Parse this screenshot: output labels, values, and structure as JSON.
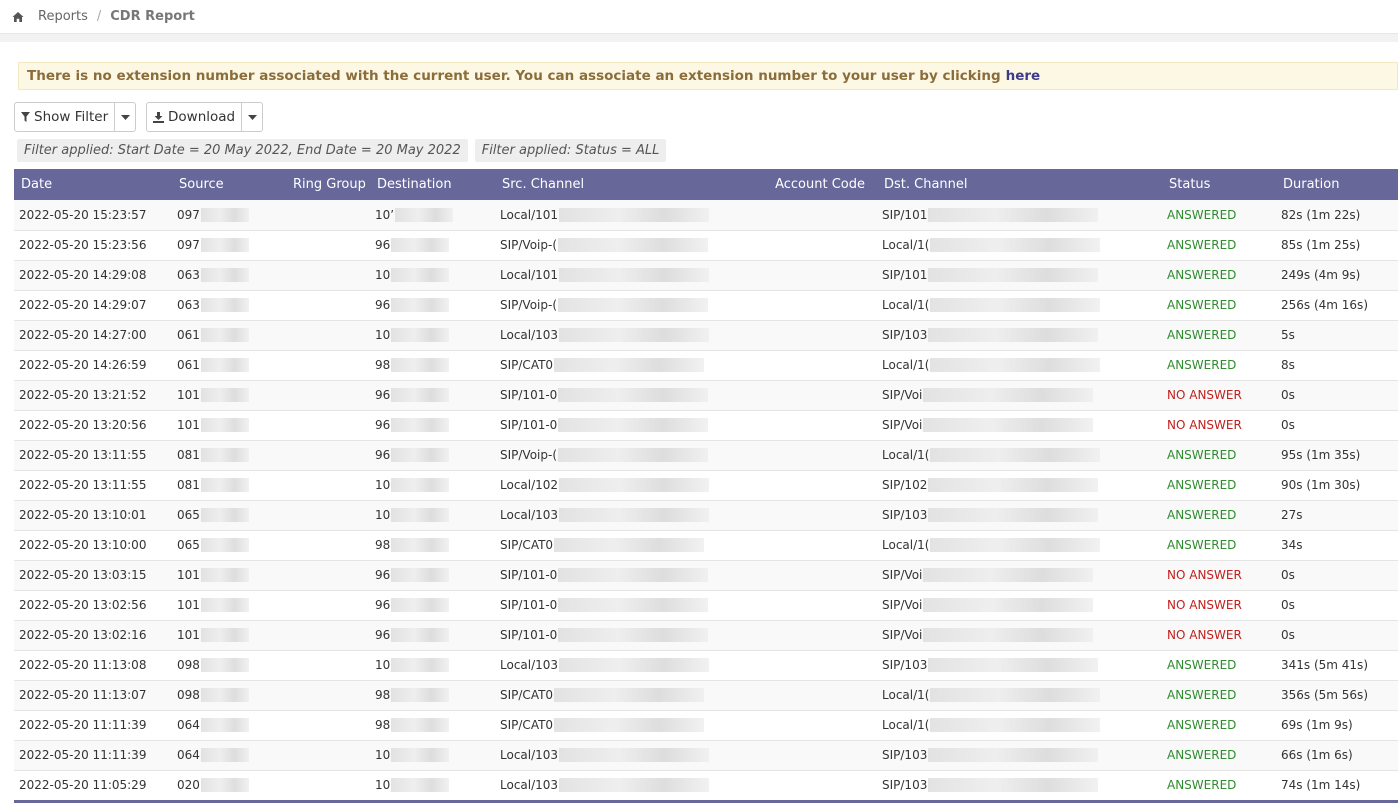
{
  "breadcrumb": {
    "root": "Reports",
    "separator": "/",
    "current": "CDR Report",
    "home_icon": "home-icon"
  },
  "alert": {
    "text": "There is no extension number associated with the current user. You can associate an extension number to your user by clicking",
    "link": "here"
  },
  "toolbar": {
    "show_filter": "Show Filter",
    "download": "Download"
  },
  "filters": [
    "Filter applied: Start Date = 20 May 2022, End Date = 20 May 2022",
    "Filter applied: Status = ALL"
  ],
  "table": {
    "columns": [
      "Date",
      "Source",
      "Ring Group",
      "Destination",
      "Src. Channel",
      "Account Code",
      "Dst. Channel",
      "Status",
      "Duration"
    ],
    "rows": [
      {
        "date": "2022-05-20 15:23:57",
        "source": "097",
        "ring": "",
        "dest": "10’",
        "src": "Local/101",
        "acct": "",
        "dst": "SIP/101",
        "status": "ANSWERED",
        "dur": "82s (1m 22s)"
      },
      {
        "date": "2022-05-20 15:23:56",
        "source": "097",
        "ring": "",
        "dest": "96",
        "src": "SIP/Voip-(",
        "acct": "",
        "dst": "Local/1(",
        "status": "ANSWERED",
        "dur": "85s (1m 25s)"
      },
      {
        "date": "2022-05-20 14:29:08",
        "source": "063",
        "ring": "",
        "dest": "10",
        "src": "Local/101",
        "acct": "",
        "dst": "SIP/101",
        "status": "ANSWERED",
        "dur": "249s (4m 9s)"
      },
      {
        "date": "2022-05-20 14:29:07",
        "source": "063",
        "ring": "",
        "dest": "96",
        "src": "SIP/Voip-(",
        "acct": "",
        "dst": "Local/1(",
        "status": "ANSWERED",
        "dur": "256s (4m 16s)"
      },
      {
        "date": "2022-05-20 14:27:00",
        "source": "061",
        "ring": "",
        "dest": "10",
        "src": "Local/103",
        "acct": "",
        "dst": "SIP/103",
        "status": "ANSWERED",
        "dur": "5s"
      },
      {
        "date": "2022-05-20 14:26:59",
        "source": "061",
        "ring": "",
        "dest": "98",
        "src": "SIP/CAT0",
        "acct": "",
        "dst": "Local/1(",
        "status": "ANSWERED",
        "dur": "8s"
      },
      {
        "date": "2022-05-20 13:21:52",
        "source": "101",
        "ring": "",
        "dest": "96",
        "src": "SIP/101-0",
        "acct": "",
        "dst": "SIP/Voi",
        "status": "NO ANSWER",
        "dur": "0s"
      },
      {
        "date": "2022-05-20 13:20:56",
        "source": "101",
        "ring": "",
        "dest": "96",
        "src": "SIP/101-0",
        "acct": "",
        "dst": "SIP/Voi",
        "status": "NO ANSWER",
        "dur": "0s"
      },
      {
        "date": "2022-05-20 13:11:55",
        "source": "081",
        "ring": "",
        "dest": "96",
        "src": "SIP/Voip-(",
        "acct": "",
        "dst": "Local/1(",
        "status": "ANSWERED",
        "dur": "95s (1m 35s)"
      },
      {
        "date": "2022-05-20 13:11:55",
        "source": "081",
        "ring": "",
        "dest": "10",
        "src": "Local/102",
        "acct": "",
        "dst": "SIP/102",
        "status": "ANSWERED",
        "dur": "90s (1m 30s)"
      },
      {
        "date": "2022-05-20 13:10:01",
        "source": "065",
        "ring": "",
        "dest": "10",
        "src": "Local/103",
        "acct": "",
        "dst": "SIP/103",
        "status": "ANSWERED",
        "dur": "27s"
      },
      {
        "date": "2022-05-20 13:10:00",
        "source": "065",
        "ring": "",
        "dest": "98",
        "src": "SIP/CAT0",
        "acct": "",
        "dst": "Local/1(",
        "status": "ANSWERED",
        "dur": "34s"
      },
      {
        "date": "2022-05-20 13:03:15",
        "source": "101",
        "ring": "",
        "dest": "96",
        "src": "SIP/101-0",
        "acct": "",
        "dst": "SIP/Voi",
        "status": "NO ANSWER",
        "dur": "0s"
      },
      {
        "date": "2022-05-20 13:02:56",
        "source": "101",
        "ring": "",
        "dest": "96",
        "src": "SIP/101-0",
        "acct": "",
        "dst": "SIP/Voi",
        "status": "NO ANSWER",
        "dur": "0s"
      },
      {
        "date": "2022-05-20 13:02:16",
        "source": "101",
        "ring": "",
        "dest": "96",
        "src": "SIP/101-0",
        "acct": "",
        "dst": "SIP/Voi",
        "status": "NO ANSWER",
        "dur": "0s"
      },
      {
        "date": "2022-05-20 11:13:08",
        "source": "098",
        "ring": "",
        "dest": "10",
        "src": "Local/103",
        "acct": "",
        "dst": "SIP/103",
        "status": "ANSWERED",
        "dur": "341s (5m 41s)"
      },
      {
        "date": "2022-05-20 11:13:07",
        "source": "098",
        "ring": "",
        "dest": "98",
        "src": "SIP/CAT0",
        "acct": "",
        "dst": "Local/1(",
        "status": "ANSWERED",
        "dur": "356s (5m 56s)"
      },
      {
        "date": "2022-05-20 11:11:39",
        "source": "064",
        "ring": "",
        "dest": "98",
        "src": "SIP/CAT0",
        "acct": "",
        "dst": "Local/1(",
        "status": "ANSWERED",
        "dur": "69s (1m 9s)"
      },
      {
        "date": "2022-05-20 11:11:39",
        "source": "064",
        "ring": "",
        "dest": "10",
        "src": "Local/103",
        "acct": "",
        "dst": "SIP/103",
        "status": "ANSWERED",
        "dur": "66s (1m 6s)"
      },
      {
        "date": "2022-05-20 11:05:29",
        "source": "020",
        "ring": "",
        "dest": "10",
        "src": "Local/103",
        "acct": "",
        "dst": "SIP/103",
        "status": "ANSWERED",
        "dur": "74s (1m 14s)"
      }
    ]
  },
  "colors": {
    "header_bg": "#67679a",
    "answered": "#2e8b2e",
    "no_answer": "#c0201e",
    "alert_bg": "#fdf8e4"
  }
}
